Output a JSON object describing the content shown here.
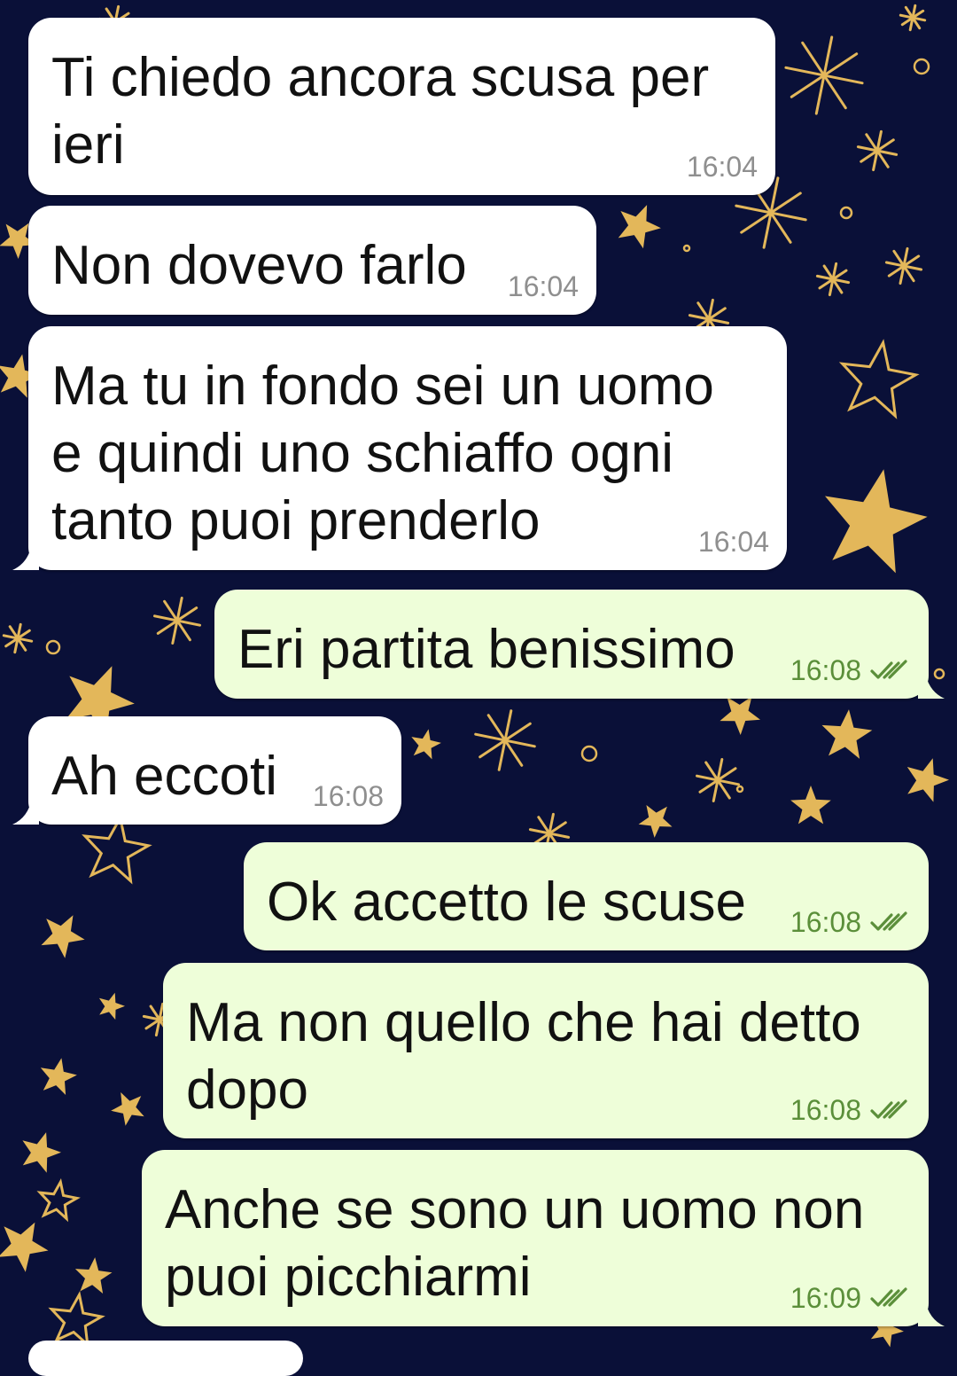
{
  "chat": {
    "messages": [
      {
        "direction": "in",
        "text": "Ti chiedo ancora scusa per\nieri",
        "time": "16:04"
      },
      {
        "direction": "in",
        "text": "Non dovevo farlo",
        "time": "16:04"
      },
      {
        "direction": "in",
        "text": "Ma tu in fondo sei un uomo\ne quindi uno schiaffo ogni\ntanto puoi prenderlo",
        "time": "16:04"
      },
      {
        "direction": "out",
        "text": "Eri partita benissimo",
        "time": "16:08",
        "status": "read-double-check-icon"
      },
      {
        "direction": "in",
        "text": "Ah eccoti",
        "time": "16:08"
      },
      {
        "direction": "out",
        "text": "Ok accetto le scuse",
        "time": "16:08",
        "status": "read-double-check-icon"
      },
      {
        "direction": "out",
        "text": "Ma non quello che hai detto\ndopo",
        "time": "16:08",
        "status": "read-double-check-icon"
      },
      {
        "direction": "out",
        "text": "Anche se sono un uomo non\npuoi picchiarmi",
        "time": "16:09",
        "status": "read-double-check-icon"
      }
    ]
  },
  "theme": {
    "wallpaper": "#0a1038",
    "star_gold": "#e3b75a",
    "incoming_bubble": "#ffffff",
    "outgoing_bubble": "#eefed9",
    "outgoing_meta": "#5b8f3a",
    "incoming_meta": "#8f8f8f"
  }
}
